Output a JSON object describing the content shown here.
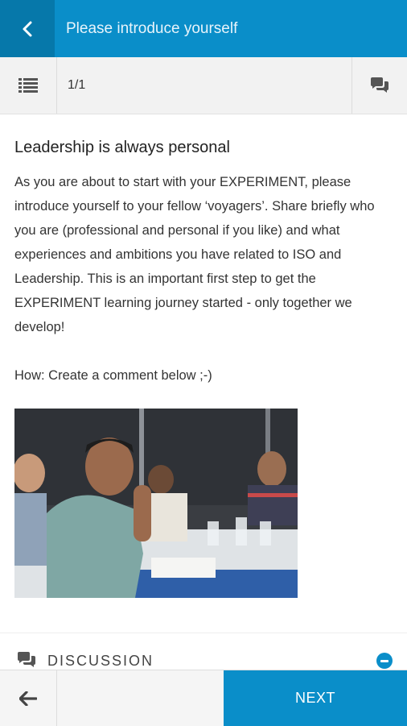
{
  "header": {
    "title": "Please introduce yourself",
    "back_icon": "chevron-left-icon"
  },
  "toolbar": {
    "list_icon": "list-icon",
    "page_counter": "1/1",
    "chat_icon": "comments-icon"
  },
  "lesson": {
    "title": "Leadership is always personal",
    "body": "As you are about to start with your EXPERIMENT, please introduce yourself to your fellow ‘voyagers’. Share briefly who you are (professional and personal if you like) and what experiences and ambitions you have related to ISO and Leadership. This is an important first step to get the EXPERIMENT learning journey started - only together we develop!",
    "how": "How: Create a comment below ;-)"
  },
  "discussion": {
    "label": "DISCUSSION",
    "icon": "comments-icon",
    "toggle_icon": "minus-circle-icon"
  },
  "footer": {
    "prev_icon": "arrow-left-icon",
    "next_label": "NEXT"
  },
  "colors": {
    "primary": "#0a8ec9",
    "primary_dark": "#0678aa",
    "toolbar_bg": "#f2f2f2"
  }
}
